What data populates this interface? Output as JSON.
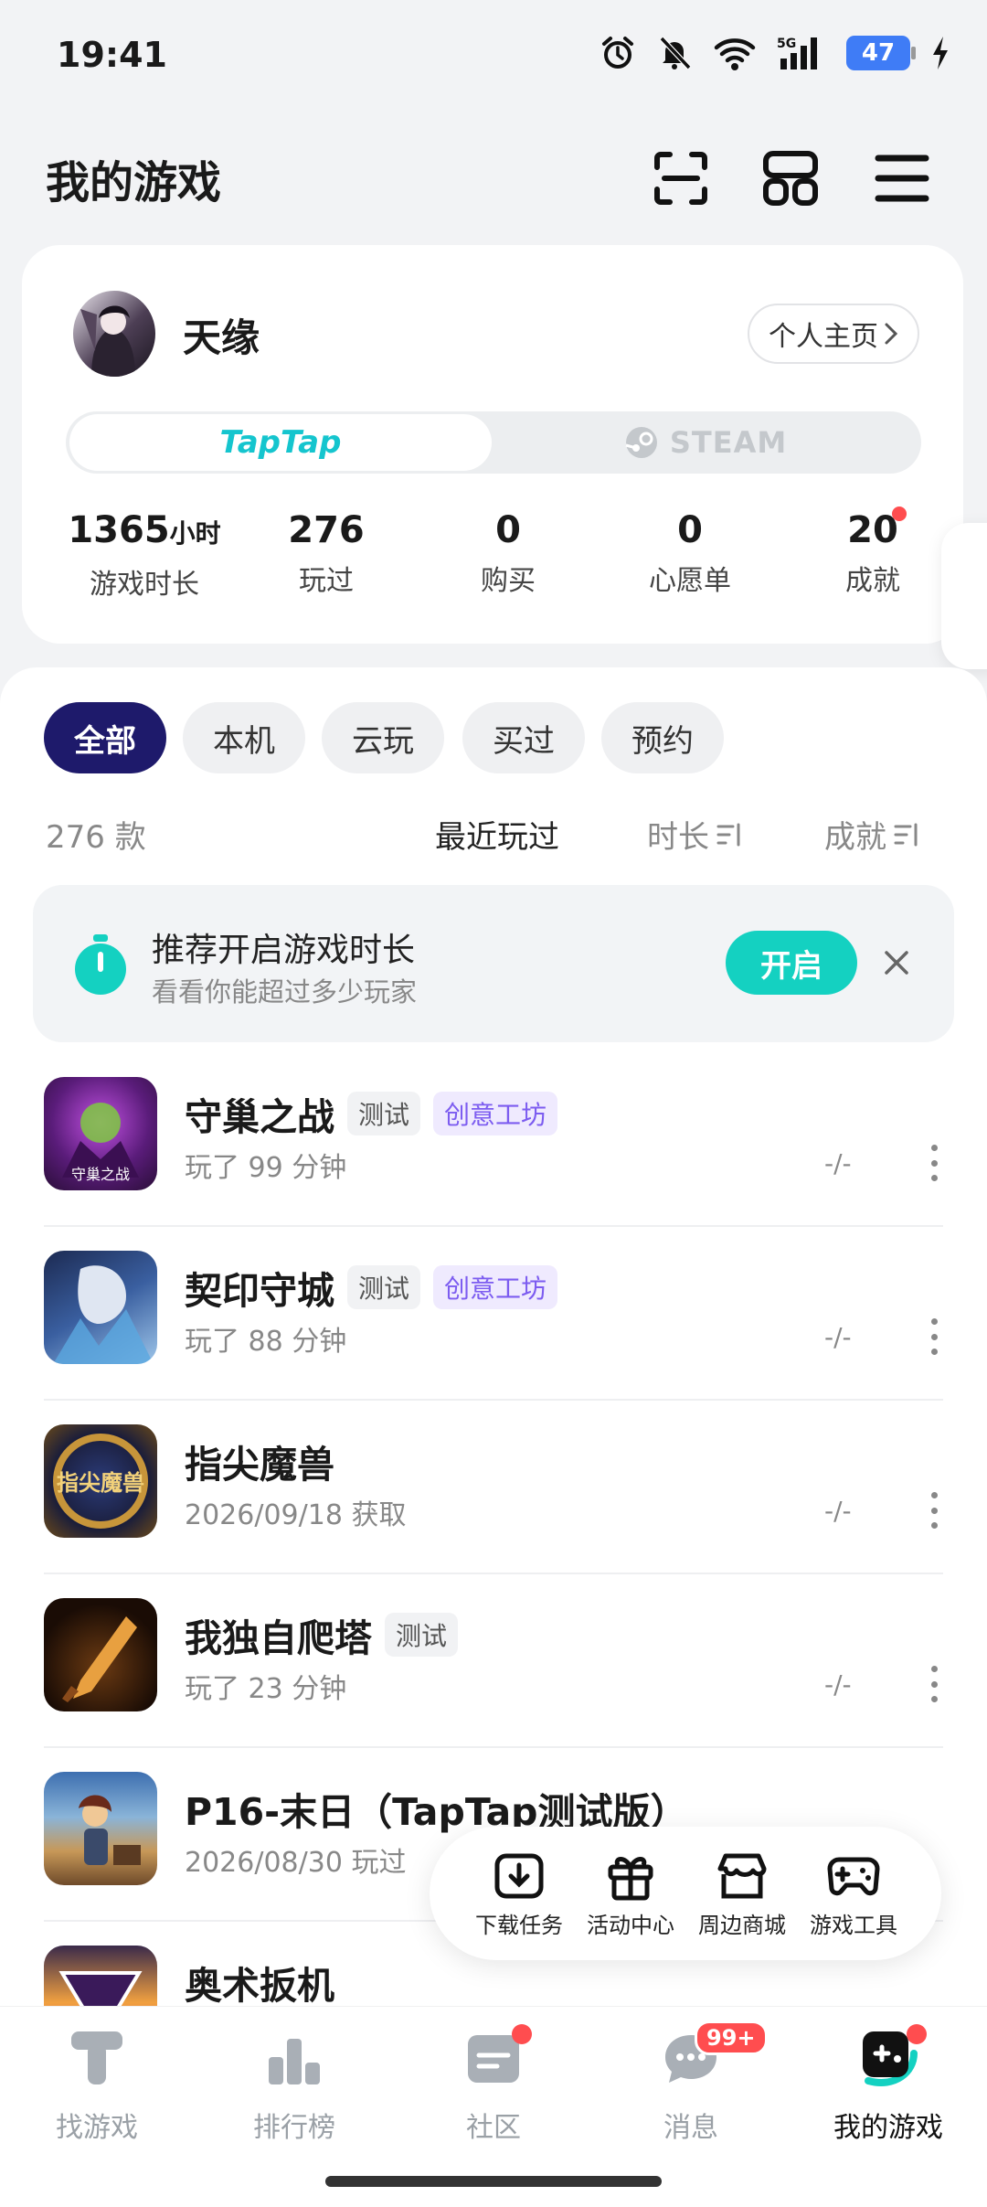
{
  "status_bar": {
    "time": "19:41",
    "battery": "47",
    "network": "5G"
  },
  "header": {
    "title": "我的游戏"
  },
  "profile": {
    "name": "天缘",
    "profile_button": "个人主页",
    "platform_active": "TapTap",
    "platform_inactive": "STEAM",
    "stats": [
      {
        "value": "1365",
        "unit": "小时",
        "label": "游戏时长"
      },
      {
        "value": "276",
        "unit": "",
        "label": "玩过"
      },
      {
        "value": "0",
        "unit": "",
        "label": "购买"
      },
      {
        "value": "0",
        "unit": "",
        "label": "心愿单"
      },
      {
        "value": "20",
        "unit": "",
        "label": "成就"
      }
    ]
  },
  "filters": [
    "全部",
    "本机",
    "云玩",
    "买过",
    "预约"
  ],
  "list_meta": {
    "count": "276 款",
    "sort_recent": "最近玩过",
    "sort_duration": "时长",
    "sort_achievement": "成就"
  },
  "tip": {
    "title": "推荐开启游戏时长",
    "subtitle": "看看你能超过多少玩家",
    "button": "开启"
  },
  "games": [
    {
      "name": "守巢之战",
      "tags": [
        "测试",
        "创意工坊"
      ],
      "sub": "玩了 99 分钟",
      "score": "-/-"
    },
    {
      "name": "契印守城",
      "tags": [
        "测试",
        "创意工坊"
      ],
      "sub": "玩了 88 分钟",
      "score": "-/-"
    },
    {
      "name": "指尖魔兽",
      "tags": [],
      "sub": "2026/09/18 获取",
      "score": "-/-"
    },
    {
      "name": "我独自爬塔",
      "tags": [
        "测试"
      ],
      "sub": "玩了 23 分钟",
      "score": "-/-"
    },
    {
      "name": "P16-末日（TapTap测试版）",
      "tags": [],
      "sub": "2026/08/30 玩过",
      "score": ""
    },
    {
      "name": "奥术扳机",
      "tags": [],
      "sub": "",
      "score": ""
    }
  ],
  "tools": [
    "下载任务",
    "活动中心",
    "周边商城",
    "游戏工具"
  ],
  "nav": [
    {
      "label": "找游戏",
      "badge": ""
    },
    {
      "label": "排行榜",
      "badge": ""
    },
    {
      "label": "社区",
      "badge": ""
    },
    {
      "label": "消息",
      "badge": "99+"
    },
    {
      "label": "我的游戏",
      "badge": ""
    }
  ],
  "colors": {
    "accent": "#14d1c1",
    "filter_active": "#1e1a6b",
    "badge": "#ff4d4f",
    "tag_purple": "#7c5cf0"
  }
}
